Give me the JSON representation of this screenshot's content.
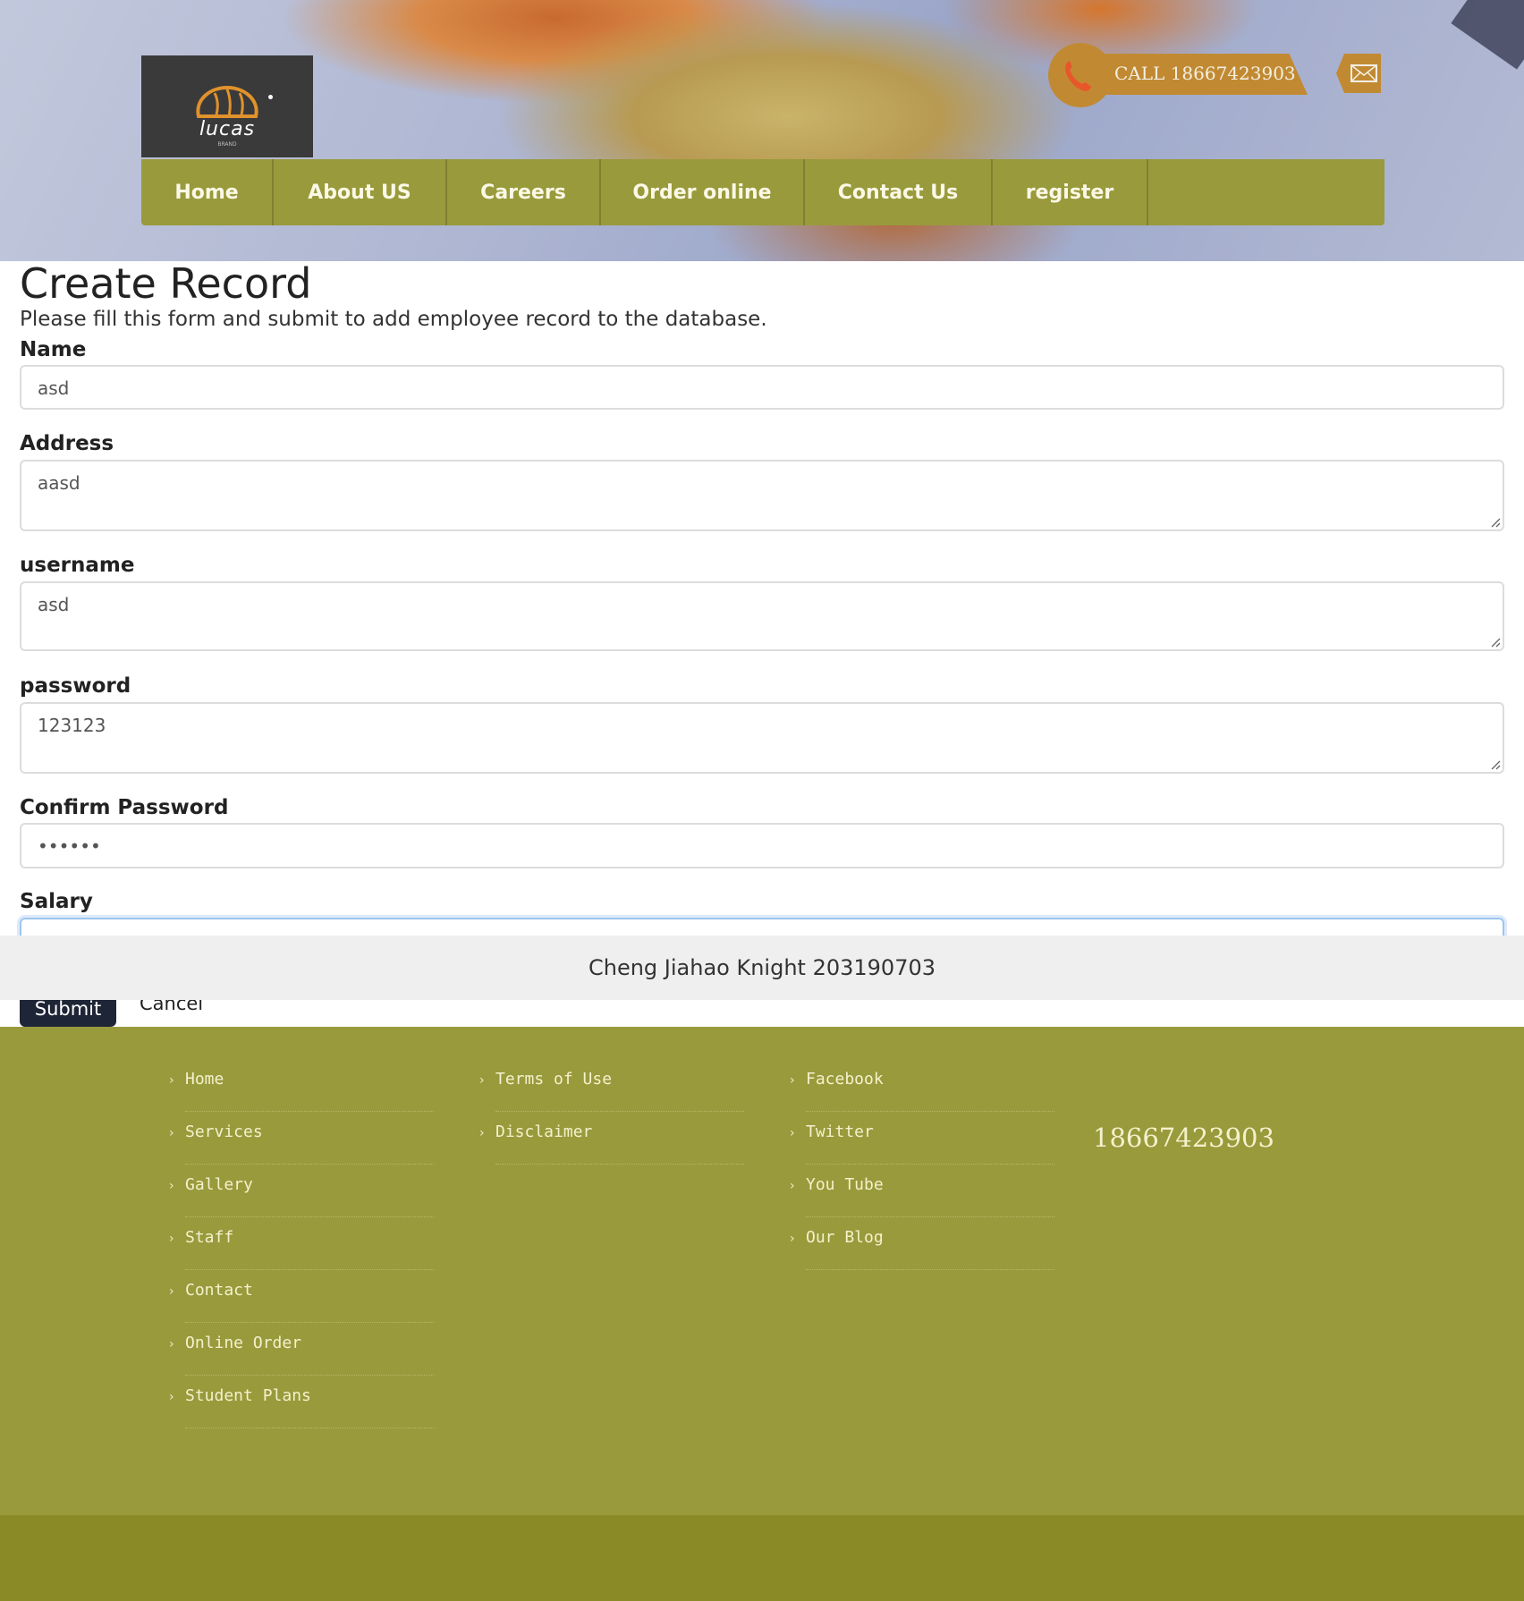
{
  "header": {
    "logo_text": "lucas",
    "logo_subtext": "BRAND",
    "call_text": "CALL  18667423903"
  },
  "nav": {
    "items": [
      {
        "label": "Home"
      },
      {
        "label": "About US"
      },
      {
        "label": "Careers"
      },
      {
        "label": "Order online"
      },
      {
        "label": "Contact Us"
      },
      {
        "label": "register"
      }
    ]
  },
  "form": {
    "title": "Create Record",
    "description": "Please fill this form and submit to add employee record to the database.",
    "name_label": "Name",
    "name_value": "asd",
    "address_label": "Address",
    "address_value": "aasd",
    "username_label": "username",
    "username_value": "asd",
    "password_label": "password",
    "password_value": "123123",
    "confirm_label": "Confirm Password",
    "confirm_value": "••••••",
    "salary_label": "Salary",
    "submit_label": "Submit",
    "cancel_label": "Cancel"
  },
  "overlay": {
    "text": "Cheng Jiahao Knight 203190703"
  },
  "footer": {
    "col1": [
      "Home",
      "Services",
      "Gallery",
      "Staff",
      "Contact",
      "Online Order",
      "Student Plans"
    ],
    "col2": [
      "Terms of Use",
      "Disclaimer"
    ],
    "col3": [
      "Facebook",
      "Twitter",
      "You Tube",
      "Our Blog"
    ],
    "phone": "18667423903"
  },
  "colors": {
    "nav_bg": "#999a3c",
    "accent_gold": "#c18a32",
    "footer_bg": "#999a3c",
    "submit_bg": "#1e2536"
  }
}
